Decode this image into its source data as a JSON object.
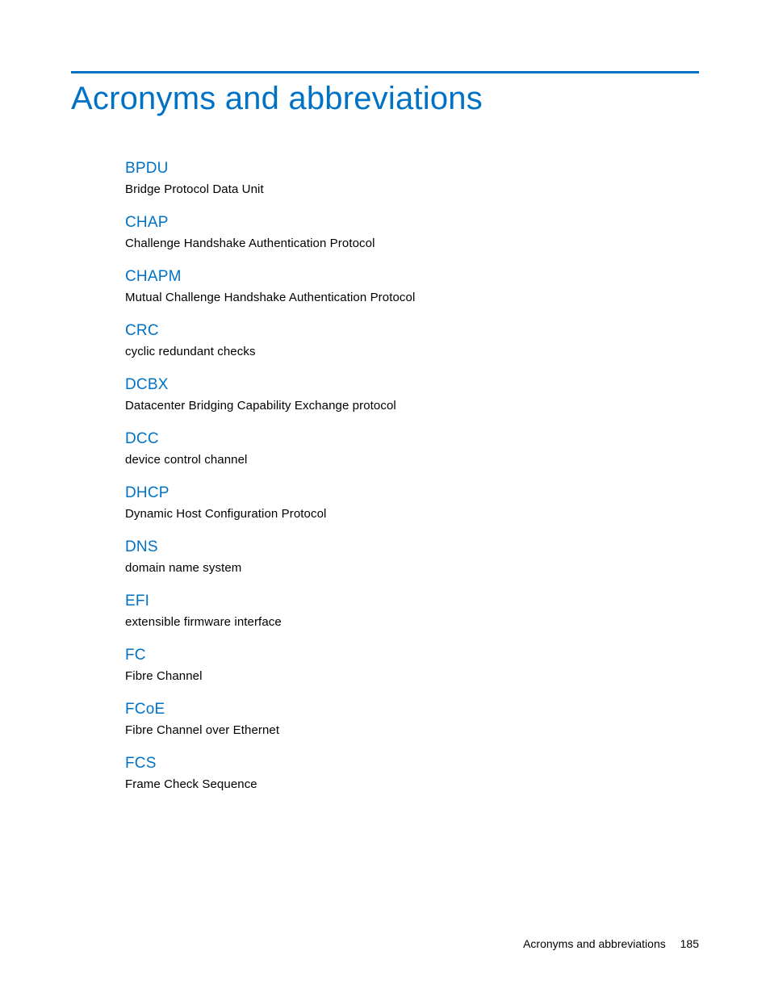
{
  "page": {
    "title": "Acronyms and abbreviations",
    "footer_section": "Acronyms and abbreviations",
    "footer_page": "185"
  },
  "entries": [
    {
      "acronym": "BPDU",
      "definition": "Bridge Protocol Data Unit"
    },
    {
      "acronym": "CHAP",
      "definition": "Challenge Handshake Authentication Protocol"
    },
    {
      "acronym": "CHAPM",
      "definition": "Mutual Challenge Handshake Authentication Protocol"
    },
    {
      "acronym": "CRC",
      "definition": "cyclic redundant checks"
    },
    {
      "acronym": "DCBX",
      "definition": "Datacenter Bridging Capability Exchange protocol"
    },
    {
      "acronym": "DCC",
      "definition": "device control channel"
    },
    {
      "acronym": "DHCP",
      "definition": "Dynamic Host Configuration Protocol"
    },
    {
      "acronym": "DNS",
      "definition": "domain name system"
    },
    {
      "acronym": "EFI",
      "definition": "extensible firmware interface"
    },
    {
      "acronym": "FC",
      "definition": "Fibre Channel"
    },
    {
      "acronym": "FCoE",
      "definition": "Fibre Channel over Ethernet"
    },
    {
      "acronym": "FCS",
      "definition": "Frame Check Sequence"
    }
  ]
}
